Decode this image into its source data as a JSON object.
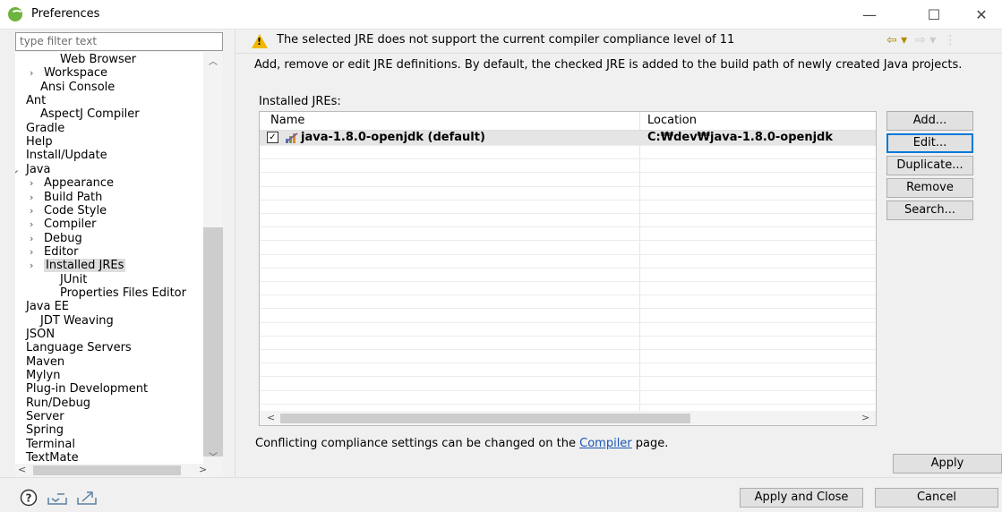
{
  "window": {
    "title": "Preferences",
    "minimize_glyph": "—",
    "maximize_glyph": "☐",
    "close_glyph": "✕"
  },
  "filter": {
    "placeholder": "type filter text"
  },
  "tree": {
    "items": [
      {
        "label": "Web Browser",
        "arrow": ""
      },
      {
        "label": "Workspace",
        "arrow": ">"
      },
      {
        "label": "Ansi Console",
        "arrow": ""
      },
      {
        "label": "Ant",
        "arrow": ">"
      },
      {
        "label": "AspectJ Compiler",
        "arrow": ""
      },
      {
        "label": "Gradle",
        "arrow": ">"
      },
      {
        "label": "Help",
        "arrow": ">"
      },
      {
        "label": "Install/Update",
        "arrow": ">"
      },
      {
        "label": "Java",
        "arrow": "v"
      },
      {
        "label": "Appearance",
        "arrow": ">"
      },
      {
        "label": "Build Path",
        "arrow": ">"
      },
      {
        "label": "Code Style",
        "arrow": ">"
      },
      {
        "label": "Compiler",
        "arrow": ">"
      },
      {
        "label": "Debug",
        "arrow": ">"
      },
      {
        "label": "Editor",
        "arrow": ">"
      },
      {
        "label": "Installed JREs",
        "arrow": ">"
      },
      {
        "label": "JUnit",
        "arrow": ""
      },
      {
        "label": "Properties Files Editor",
        "arrow": ""
      },
      {
        "label": "Java EE",
        "arrow": ">"
      },
      {
        "label": "JDT Weaving",
        "arrow": ""
      },
      {
        "label": "JSON",
        "arrow": ">"
      },
      {
        "label": "Language Servers",
        "arrow": ">"
      },
      {
        "label": "Maven",
        "arrow": ">"
      },
      {
        "label": "Mylyn",
        "arrow": ">"
      },
      {
        "label": "Plug-in Development",
        "arrow": ">"
      },
      {
        "label": "Run/Debug",
        "arrow": ">"
      },
      {
        "label": "Server",
        "arrow": ">"
      },
      {
        "label": "Spring",
        "arrow": ">"
      },
      {
        "label": "Terminal",
        "arrow": ">"
      },
      {
        "label": "TextMate",
        "arrow": ">"
      }
    ],
    "selected": "Installed JREs"
  },
  "header": {
    "warning": "The selected JRE does not support the current compiler compliance level of 11"
  },
  "main": {
    "description": "Add, remove or edit JRE definitions. By default, the checked JRE is added to the build path of newly created Java projects.",
    "installed_label": "Installed JREs:",
    "columns": [
      "Name",
      "Location"
    ],
    "jres": [
      {
        "name": "java-1.8.0-openjdk (default)",
        "location": "C:₩dev₩java-1.8.0-openjdk",
        "checked": true
      }
    ],
    "conflict_prefix": "Conflicting compliance settings can be changed on the ",
    "conflict_link": "Compiler",
    "conflict_suffix": " page."
  },
  "buttons": {
    "add": "Add...",
    "edit": "Edit...",
    "duplicate": "Duplicate...",
    "remove": "Remove",
    "search": "Search...",
    "apply": "Apply",
    "apply_close": "Apply and Close",
    "cancel": "Cancel"
  },
  "colors": {
    "warning": "#f0b800",
    "link": "#1a55b5",
    "focus": "#0078d7",
    "selection": "#e5e5e5"
  }
}
